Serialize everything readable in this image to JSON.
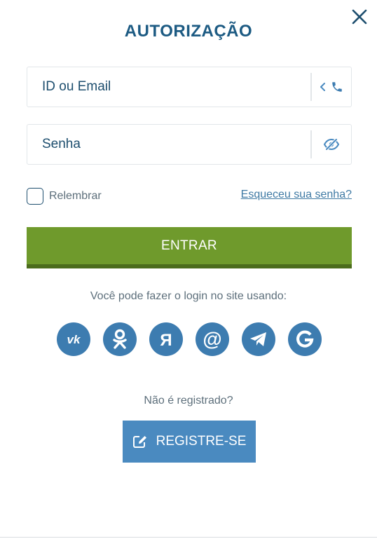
{
  "dialog": {
    "title": "AUTORIZAÇÃO"
  },
  "login_field": {
    "placeholder": "ID ou Email",
    "value": "",
    "toggle_icon": "chevron-left-icon",
    "switch_icon": "phone-icon"
  },
  "password_field": {
    "placeholder": "Senha",
    "value": "",
    "toggle_icon": "eye-slash-icon"
  },
  "remember": {
    "label": "Relembrar",
    "checked": false
  },
  "forgot_password": {
    "label": "Esqueceu sua senha?"
  },
  "submit": {
    "label": "ENTRAR"
  },
  "social": {
    "caption": "Você pode fazer o login no site usando:",
    "providers": [
      {
        "icon": "vk-icon"
      },
      {
        "icon": "odnoklassniki-icon"
      },
      {
        "icon": "yandex-icon"
      },
      {
        "icon": "mail-at-icon"
      },
      {
        "icon": "telegram-icon"
      },
      {
        "icon": "google-icon"
      }
    ]
  },
  "register": {
    "prompt": "Não é registrado?",
    "button_label": "REGISTRE-SE",
    "icon": "edit-icon"
  },
  "colors": {
    "title": "#1d5b83",
    "primary_button": "#6f9a2c",
    "social_circle": "#3d7cb0",
    "register_button": "#4a8ac0"
  }
}
